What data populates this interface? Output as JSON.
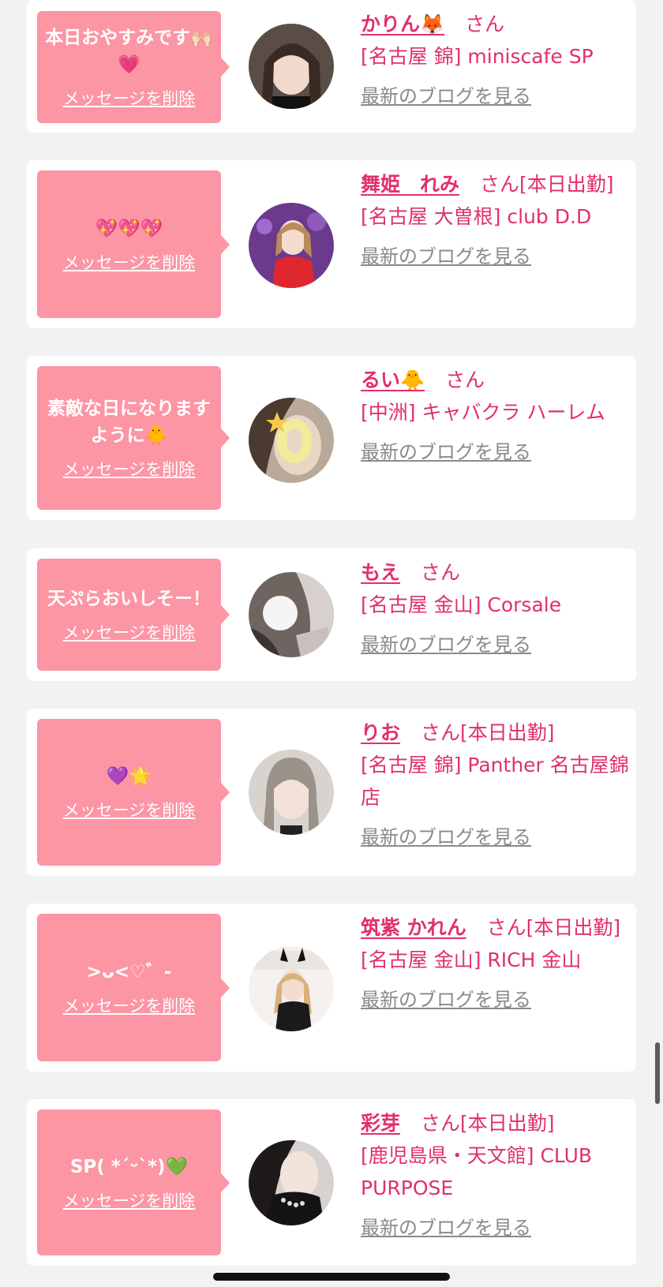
{
  "cards": [
    {
      "message": "本日おやすみです🙌🏻💗",
      "delete_label": "メッセージを削除",
      "name": "かりん🦊",
      "suffix": "さん",
      "store": "[名古屋 錦] miniscafe SP",
      "blog_label": "最新のブログを見る"
    },
    {
      "message": "💖💖💖",
      "delete_label": "メッセージを削除",
      "name": "舞姫　れみ",
      "suffix": "さん[本日出勤]",
      "store": "[名古屋 大曽根] club D.D",
      "blog_label": "最新のブログを見る"
    },
    {
      "message": "素敵な日になりますように🐥",
      "delete_label": "メッセージを削除",
      "name": "るい🐥",
      "suffix": "さん",
      "store": "[中洲] キャバクラ ハーレム",
      "blog_label": "最新のブログを見る"
    },
    {
      "message": "天ぷらおいしそー！",
      "delete_label": "メッセージを削除",
      "name": "もえ",
      "suffix": "さん",
      "store": "[名古屋 金山] Corsale",
      "blog_label": "最新のブログを見る"
    },
    {
      "message": "💜🌟",
      "delete_label": "メッセージを削除",
      "name": "りお",
      "suffix": "さん[本日出勤]",
      "store": "[名古屋 錦] Panther 名古屋錦店",
      "blog_label": "最新のブログを見る"
    },
    {
      "message": ">ᴗ<♡゛-",
      "delete_label": "メッセージを削除",
      "name": "筑紫 かれん",
      "suffix": "さん[本日出勤]",
      "store": "[名古屋 金山] RICH 金山",
      "blog_label": "最新のブログを見る"
    },
    {
      "message": "SP( *ˊᵕˋ*)💚",
      "delete_label": "メッセージを削除",
      "name": "彩芽",
      "suffix": "さん[本日出勤]",
      "store": "[鹿児島県・天文館] CLUB PURPOSE",
      "blog_label": "最新のブログを見る"
    }
  ],
  "colors": {
    "bubble": "#fc95a4",
    "accent": "#e0306a",
    "link_gray": "#8a8a8a",
    "background": "#f2f2f3"
  }
}
